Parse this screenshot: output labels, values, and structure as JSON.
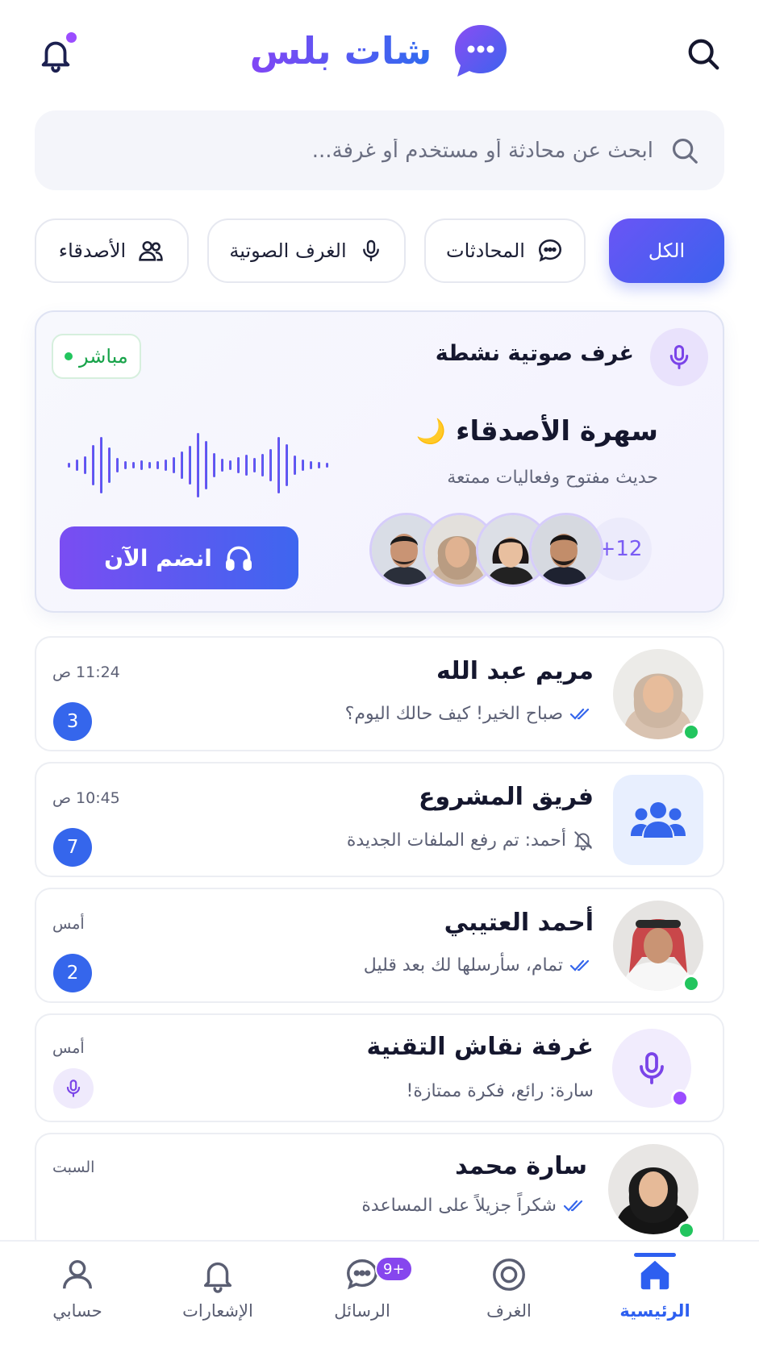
{
  "app": {
    "title": "شات بلس"
  },
  "colors": {
    "primary": "#3566ec",
    "accent": "#8246f5",
    "live": "#22c55e"
  },
  "search": {
    "placeholder": "ابحث عن محادثة أو مستخدم أو غرفة..."
  },
  "filters": [
    {
      "label": "الكل",
      "icon": "none",
      "active": true
    },
    {
      "label": "المحادثات",
      "icon": "chat-bubble-icon",
      "active": false
    },
    {
      "label": "الغرف الصوتية",
      "icon": "microphone-icon",
      "active": false
    },
    {
      "label": "الأصدقاء",
      "icon": "users-icon",
      "active": false
    }
  ],
  "live_rooms": {
    "title": "غرف صوتية نشطة",
    "badge": "مباشر",
    "room_name": "سهرة الأصدقاء",
    "room_emoji": "🌙",
    "room_description": "حديث مفتوح وفعاليات ممتعة",
    "extra_count": "+12",
    "join_label": "انضم الآن"
  },
  "chats": [
    {
      "name": "مريم عبد الله",
      "preview": "صباح الخير! كيف حالك اليوم؟",
      "time": "11:24 ص",
      "unread": "3",
      "status_icon": "double-check-icon",
      "online": true
    },
    {
      "name": "فريق المشروع",
      "preview": "أحمد: تم رفع الملفات الجديدة",
      "time": "10:45 ص",
      "unread": "7",
      "status_icon": "muted-bell-icon",
      "online": false
    },
    {
      "name": "أحمد العتيبي",
      "preview": "تمام، سأرسلها لك بعد قليل",
      "time": "أمس",
      "unread": "2",
      "status_icon": "double-check-icon",
      "online": true
    },
    {
      "name": "غرفة نقاش التقنية",
      "preview": "سارة:  رائع، فكرة ممتازة!",
      "time": "أمس",
      "unread": "",
      "status_icon": "microphone-icon",
      "online": false
    },
    {
      "name": "سارة محمد",
      "preview": "شكراً جزيلاً على المساعدة",
      "time": "السبت",
      "unread": "",
      "status_icon": "double-check-icon",
      "online": true
    }
  ],
  "bottom_nav": [
    {
      "label": "الرئيسية",
      "icon": "home-icon",
      "active": true
    },
    {
      "label": "الغرف",
      "icon": "rooms-icon",
      "active": false
    },
    {
      "label": "الرسائل",
      "icon": "messages-icon",
      "active": false,
      "badge": "9+"
    },
    {
      "label": "الإشعارات",
      "icon": "bell-icon",
      "active": false
    },
    {
      "label": "حسابي",
      "icon": "profile-icon",
      "active": false
    }
  ]
}
